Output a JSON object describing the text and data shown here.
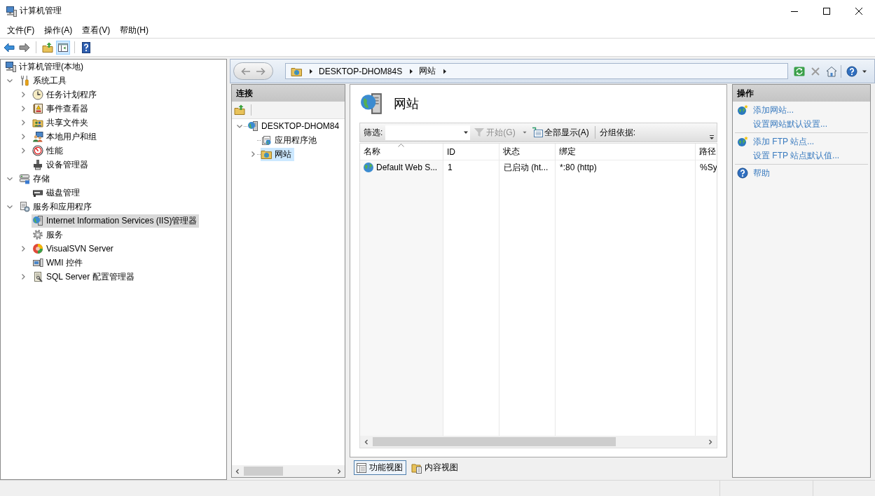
{
  "window": {
    "title": "计算机管理"
  },
  "menu": [
    "文件(F)",
    "操作(A)",
    "查看(V)",
    "帮助(H)"
  ],
  "toolbar": [
    {
      "kind": "back",
      "disabled": false,
      "on": false
    },
    {
      "kind": "forward",
      "disabled": true,
      "on": false
    },
    {
      "kind": "separator"
    },
    {
      "kind": "up",
      "disabled": false,
      "on": false
    },
    {
      "kind": "console_tree",
      "disabled": false,
      "on": true
    },
    {
      "kind": "separator"
    },
    {
      "kind": "help",
      "disabled": false,
      "on": false
    }
  ],
  "console_tree": [
    {
      "label": "计算机管理(本地)",
      "kind": "root",
      "selected": false,
      "children": [
        {
          "label": "系统工具",
          "kind": "tools",
          "expanded": true,
          "selected": false,
          "children": [
            {
              "label": "任务计划程序",
              "kind": "scheduler",
              "expanded": false,
              "selected": false
            },
            {
              "label": "事件查看器",
              "kind": "events",
              "expanded": false,
              "selected": false
            },
            {
              "label": "共享文件夹",
              "kind": "shares",
              "expanded": false,
              "selected": false
            },
            {
              "label": "本地用户和组",
              "kind": "users",
              "expanded": false,
              "selected": false
            },
            {
              "label": "性能",
              "kind": "performance",
              "expanded": false,
              "selected": false
            },
            {
              "label": "设备管理器",
              "kind": "devices",
              "selected": false
            }
          ]
        },
        {
          "label": "存储",
          "kind": "storage",
          "expanded": true,
          "selected": false,
          "children": [
            {
              "label": "磁盘管理",
              "kind": "disk",
              "selected": false
            }
          ]
        },
        {
          "label": "服务和应用程序",
          "kind": "apps",
          "expanded": true,
          "selected": false,
          "children": [
            {
              "label": "Internet Information Services (IIS)管理器",
              "kind": "iis",
              "selected": true
            },
            {
              "label": "服务",
              "kind": "services",
              "selected": false
            },
            {
              "label": "VisualSVN Server",
              "kind": "svn",
              "expanded": false,
              "selected": false
            },
            {
              "label": "WMI 控件",
              "kind": "wmi",
              "selected": false
            },
            {
              "label": "SQL Server 配置管理器",
              "kind": "sql",
              "expanded": false,
              "selected": false
            }
          ]
        }
      ]
    }
  ],
  "iis": {
    "nav_buttons": [
      {
        "kind": "back",
        "disabled": true
      },
      {
        "kind": "forward",
        "disabled": true
      }
    ],
    "address": [
      "DESKTOP-DHOM84S",
      "网站"
    ],
    "tools": [
      {
        "kind": "refresh",
        "disabled": false
      },
      {
        "kind": "stop",
        "disabled": true
      },
      {
        "kind": "home",
        "disabled": false
      },
      {
        "kind": "separator"
      },
      {
        "kind": "help",
        "disabled": false
      },
      {
        "kind": "dropdown",
        "disabled": false
      }
    ],
    "connections": {
      "title": "连接",
      "tree": [
        {
          "label": "DESKTOP-DHOM84",
          "kind": "server",
          "expanded": true,
          "selected": false,
          "children": [
            {
              "label": "应用程序池",
              "kind": "app_pools",
              "selected": false
            },
            {
              "label": "网站",
              "kind": "sites",
              "expanded": false,
              "selected": true
            }
          ]
        }
      ]
    },
    "page": {
      "title": "网站",
      "filter": {
        "label": "筛选:",
        "start": {
          "label": "开始(G)",
          "disabled": true
        },
        "show_all": {
          "label": "全部显示(A)",
          "disabled": false
        },
        "group_by": "分组依据:"
      },
      "table": {
        "columns": [
          {
            "label": "名称",
            "sorted": true
          },
          {
            "label": "ID",
            "sorted": false
          },
          {
            "label": "状态",
            "sorted": false
          },
          {
            "label": "绑定",
            "sorted": false
          },
          {
            "label": "路径",
            "sorted": false
          }
        ],
        "rows": [
          [
            "Default Web S...",
            "1",
            "已启动 (ht...",
            "*:80 (http)",
            "%Sy"
          ]
        ]
      }
    },
    "views": [
      {
        "label": "功能视图",
        "kind": "features",
        "selected": true
      },
      {
        "label": "内容视图",
        "kind": "content",
        "selected": false
      }
    ],
    "actions": {
      "title": "操作",
      "groups": [
        [
          {
            "label": "添加网站...",
            "kind": "add"
          },
          {
            "label": "设置网站默认设置...",
            "kind": "link"
          }
        ],
        [
          {
            "label": "添加 FTP 站点...",
            "kind": "add"
          },
          {
            "label": "设置 FTP 站点默认值...",
            "kind": "link"
          }
        ],
        [
          {
            "label": "帮助",
            "kind": "help"
          }
        ]
      ]
    }
  }
}
